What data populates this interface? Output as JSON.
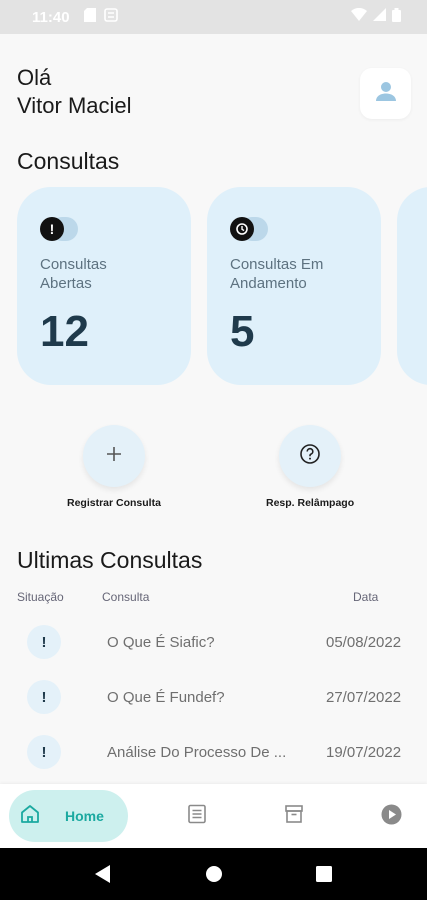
{
  "status_bar": {
    "time": "11:40"
  },
  "header": {
    "greeting_line1": "Olá",
    "greeting_line2": "Vitor Maciel"
  },
  "consultas_section": {
    "title": "Consultas"
  },
  "cards": [
    {
      "label_line1": "Consultas",
      "label_line2": "Abertas",
      "value": "12",
      "icon": "exclamation-icon"
    },
    {
      "label_line1": "Consultas Em",
      "label_line2": "Andamento",
      "value": "5",
      "icon": "clock-icon"
    }
  ],
  "actions": {
    "register": {
      "label": "Registrar Consulta",
      "icon": "plus-icon"
    },
    "quick_response": {
      "label": "Resp. Relâmpago",
      "icon": "question-icon"
    }
  },
  "recent_section": {
    "title": "Ultimas Consultas",
    "columns": {
      "status": "Situação",
      "consulta": "Consulta",
      "date": "Data"
    },
    "rows": [
      {
        "status_icon": "!",
        "title": "O Que É Siafic?",
        "date": "05/08/2022"
      },
      {
        "status_icon": "!",
        "title": "O Que É Fundef?",
        "date": "27/07/2022"
      },
      {
        "status_icon": "!",
        "title": "Análise Do Processo De ...",
        "date": "19/07/2022"
      }
    ]
  },
  "bottom_nav": {
    "home_label": "Home",
    "accent": "#1ba9a0",
    "active_bg": "#cdf0ee"
  },
  "colors": {
    "card_bg": "#dff0fa",
    "card_value": "#1f3a4b"
  }
}
